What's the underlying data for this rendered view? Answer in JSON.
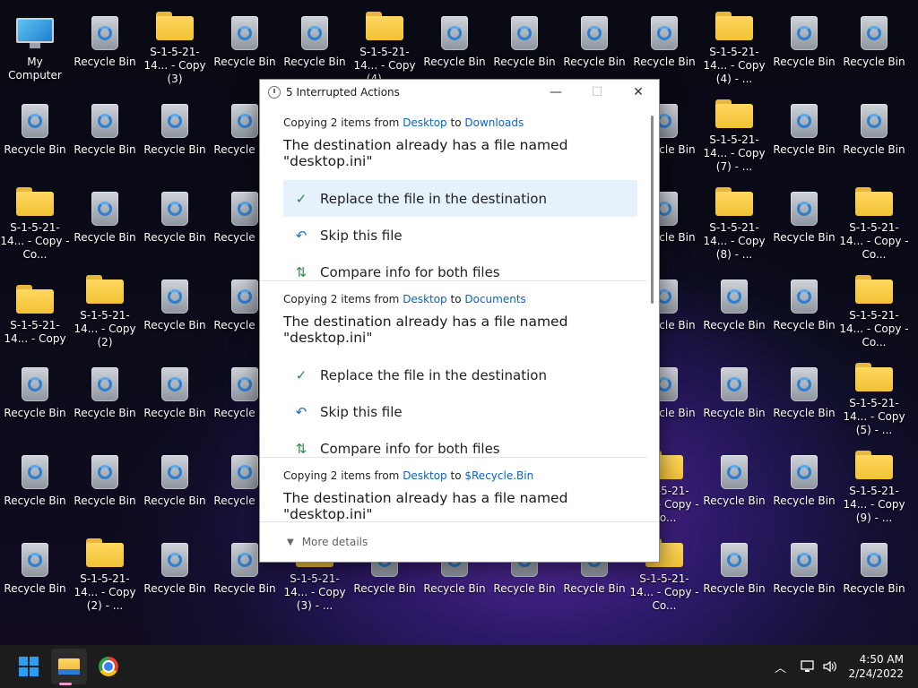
{
  "desktop_icons": [
    {
      "label": "My Computer",
      "type": "computer"
    },
    {
      "label": "Recycle Bin",
      "type": "bin"
    },
    {
      "label": "S-1-5-21-14... - Copy (3)",
      "type": "folder"
    },
    {
      "label": "Recycle Bin",
      "type": "bin"
    },
    {
      "label": "Recycle Bin",
      "type": "bin"
    },
    {
      "label": "S-1-5-21-14... - Copy (4) - ...",
      "type": "folder"
    },
    {
      "label": "Recycle Bin",
      "type": "bin"
    },
    {
      "label": "Recycle Bin",
      "type": "bin"
    },
    {
      "label": "Recycle Bin",
      "type": "bin"
    },
    {
      "label": "Recycle Bin",
      "type": "bin"
    },
    {
      "label": "S-1-5-21-14... - Copy (4) - ...",
      "type": "folder"
    },
    {
      "label": "Recycle Bin",
      "type": "bin"
    },
    {
      "label": "Recycle Bin",
      "type": "bin"
    },
    {
      "label": "Recycle Bin",
      "type": "bin"
    },
    {
      "label": "Recycle Bin",
      "type": "bin"
    },
    {
      "label": "Recycle Bin",
      "type": "bin"
    },
    {
      "label": "Recycle Bin",
      "type": "bin"
    },
    {
      "label": "Recycle Bin",
      "type": "bin"
    },
    {
      "label": "S-1-5-21-14... - Copy (7) - ...",
      "type": "folder"
    },
    {
      "label": "Recycle Bin",
      "type": "bin"
    },
    {
      "label": "Recycle Bin",
      "type": "bin"
    },
    {
      "label": "S-1-5-21-14... - Copy - Co...",
      "type": "folder"
    },
    {
      "label": "Recycle Bin",
      "type": "bin"
    },
    {
      "label": "Recycle Bin",
      "type": "bin"
    },
    {
      "label": "Recycle Bin",
      "type": "bin"
    },
    {
      "label": "Recycle Bin",
      "type": "bin"
    },
    {
      "label": "S-1-5-21-14... - Copy (8) - ...",
      "type": "folder"
    },
    {
      "label": "Recycle Bin",
      "type": "bin"
    },
    {
      "label": "S-1-5-21-14... - Copy - Co...",
      "type": "folder"
    },
    {
      "label": "S-1-5-21-14... - Copy",
      "type": "folder"
    },
    {
      "label": "S-1-5-21-14... - Copy (2)",
      "type": "folder"
    },
    {
      "label": "Recycle Bin",
      "type": "bin"
    },
    {
      "label": "Recycle Bin",
      "type": "bin"
    },
    {
      "label": "Recycle Bin",
      "type": "bin"
    },
    {
      "label": "Recycle Bin",
      "type": "bin"
    },
    {
      "label": "Recycle Bin",
      "type": "bin"
    },
    {
      "label": "S-1-5-21-14... - Copy - Co...",
      "type": "folder"
    },
    {
      "label": "Recycle Bin",
      "type": "bin"
    },
    {
      "label": "Recycle Bin",
      "type": "bin"
    },
    {
      "label": "Recycle Bin",
      "type": "bin"
    },
    {
      "label": "Recycle Bin",
      "type": "bin"
    },
    {
      "label": "Recycle Bin",
      "type": "bin"
    },
    {
      "label": "Recycle Bin",
      "type": "bin"
    },
    {
      "label": "Recycle Bin",
      "type": "bin"
    },
    {
      "label": "S-1-5-21-14... - Copy (5) - ...",
      "type": "folder"
    },
    {
      "label": "Recycle Bin",
      "type": "bin"
    },
    {
      "label": "Recycle Bin",
      "type": "bin"
    },
    {
      "label": "Recycle Bin",
      "type": "bin"
    },
    {
      "label": "Recycle Bin",
      "type": "bin"
    },
    {
      "label": "S-1-5-21-14... - Copy - Co...",
      "type": "folder"
    },
    {
      "label": "Recycle Bin",
      "type": "bin"
    },
    {
      "label": "Recycle Bin",
      "type": "bin"
    },
    {
      "label": "S-1-5-21-14... - Copy (9) - ...",
      "type": "folder"
    },
    {
      "label": "Recycle Bin",
      "type": "bin"
    },
    {
      "label": "S-1-5-21-14... - Copy (2) - ...",
      "type": "folder"
    },
    {
      "label": "Recycle Bin",
      "type": "bin"
    },
    {
      "label": "Recycle Bin",
      "type": "bin"
    },
    {
      "label": "S-1-5-21-14... - Copy (3) - ...",
      "type": "folder"
    },
    {
      "label": "Recycle Bin",
      "type": "bin"
    },
    {
      "label": "Recycle Bin",
      "type": "bin"
    },
    {
      "label": "Recycle Bin",
      "type": "bin"
    },
    {
      "label": "Recycle Bin",
      "type": "bin"
    },
    {
      "label": "S-1-5-21-14... - Copy - Co...",
      "type": "folder"
    },
    {
      "label": "Recycle Bin",
      "type": "bin"
    },
    {
      "label": "Recycle Bin",
      "type": "bin"
    },
    {
      "label": "Recycle Bin",
      "type": "bin"
    }
  ],
  "dialog": {
    "title": "5 Interrupted Actions",
    "minimize": "—",
    "maximize": "☐",
    "close": "✕",
    "groups": [
      {
        "prefix": "Copying 2 items from ",
        "from": "Desktop",
        "to_word": " to ",
        "to": "Downloads",
        "headline": "The destination already has a file named \"desktop.ini\"",
        "replace": "Replace the file in the destination",
        "skip": "Skip this file",
        "compare": "Compare info for both files"
      },
      {
        "prefix": "Copying 2 items from ",
        "from": "Desktop",
        "to_word": " to ",
        "to": "Documents",
        "headline": "The destination already has a file named \"desktop.ini\"",
        "replace": "Replace the file in the destination",
        "skip": "Skip this file",
        "compare": "Compare info for both files"
      },
      {
        "prefix": "Copying 2 items from ",
        "from": "Desktop",
        "to_word": " to ",
        "to": "$Recycle.Bin",
        "headline": "The destination already has a file named \"desktop.ini\""
      }
    ],
    "more_details": "More details"
  },
  "taskbar": {
    "time": "4:50 AM",
    "date": "2/24/2022"
  }
}
